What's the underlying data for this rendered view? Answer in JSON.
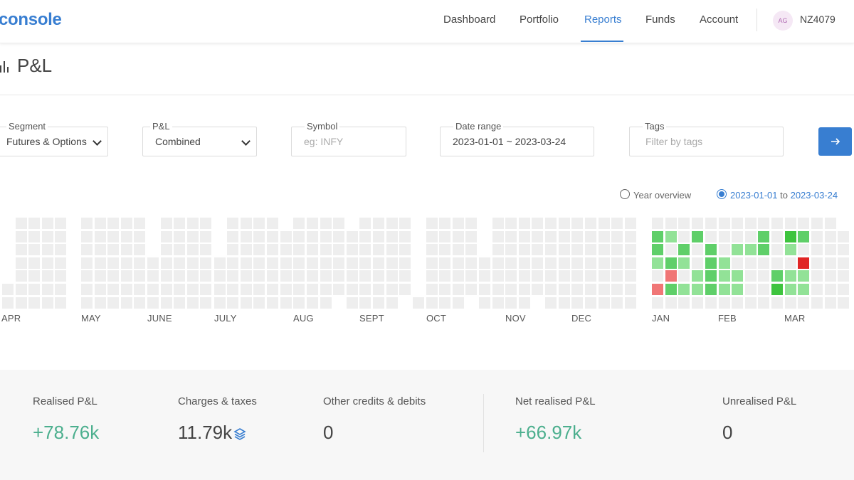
{
  "app": {
    "logo": "console"
  },
  "nav": {
    "items": [
      {
        "label": "Dashboard",
        "active": false
      },
      {
        "label": "Portfolio",
        "active": false
      },
      {
        "label": "Reports",
        "active": true
      },
      {
        "label": "Funds",
        "active": false
      },
      {
        "label": "Account",
        "active": false
      }
    ],
    "avatar_initials": "AG",
    "user_id": "NZ4079"
  },
  "page": {
    "title": "P&L"
  },
  "filters": {
    "segment": {
      "label": "Segment",
      "value": "Futures & Options"
    },
    "pnl": {
      "label": "P&L",
      "value": "Combined"
    },
    "symbol": {
      "label": "Symbol",
      "placeholder": "eg: INFY"
    },
    "date_range": {
      "label": "Date range",
      "value": "2023-01-01 ~ 2023-03-24"
    },
    "tags": {
      "label": "Tags",
      "placeholder": "Filter by tags"
    },
    "submit_icon": "arrow-right-icon"
  },
  "view_options": {
    "year_overview": {
      "label": "Year overview",
      "checked": false
    },
    "range": {
      "from": "2023-01-01",
      "to_word": "to",
      "to": "2023-03-24",
      "checked": true
    }
  },
  "heatmap": {
    "months": [
      "APR",
      "MAY",
      "JUNE",
      "JULY",
      "AUG",
      "SEPT",
      "OCT",
      "NOV",
      "DEC",
      "JAN",
      "FEB",
      "MAR"
    ],
    "colors": {
      "empty": "#eeeeee",
      "profit_light": "#92e297",
      "profit": "#5fcf69",
      "profit_dark": "#3ec43e",
      "loss_light": "#f07676",
      "loss": "#e02424"
    }
  },
  "summary": {
    "realised": {
      "label": "Realised P&L",
      "value": "+78.76k"
    },
    "charges": {
      "label": "Charges & taxes",
      "value": "11.79k",
      "icon": "layers-icon"
    },
    "other": {
      "label": "Other credits & debits",
      "value": "0"
    },
    "net": {
      "label": "Net realised P&L",
      "value": "+66.97k"
    },
    "unrealised": {
      "label": "Unrealised P&L",
      "value": "0"
    }
  }
}
